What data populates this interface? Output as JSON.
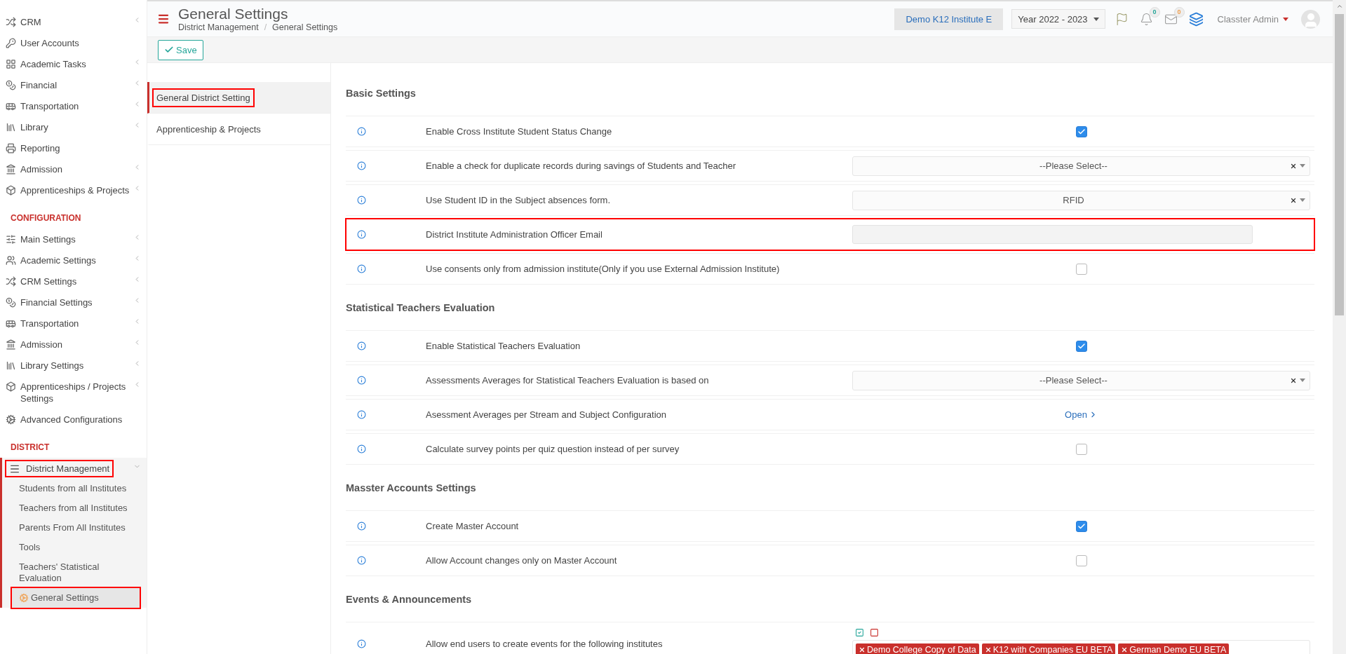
{
  "sidebar": {
    "groups": [
      {
        "items": [
          {
            "label": "CRM",
            "expandable": true
          },
          {
            "label": "User Accounts",
            "expandable": false
          },
          {
            "label": "Academic Tasks",
            "expandable": true
          },
          {
            "label": "Financial",
            "expandable": true
          },
          {
            "label": "Transportation",
            "expandable": true
          },
          {
            "label": "Library",
            "expandable": true
          },
          {
            "label": "Reporting",
            "expandable": false
          },
          {
            "label": "Admission",
            "expandable": true
          },
          {
            "label": "Apprenticeships & Projects",
            "expandable": true
          }
        ]
      },
      {
        "heading": "CONFIGURATION",
        "items": [
          {
            "label": "Main Settings",
            "expandable": true
          },
          {
            "label": "Academic Settings",
            "expandable": true
          },
          {
            "label": "CRM Settings",
            "expandable": true
          },
          {
            "label": "Financial Settings",
            "expandable": true
          },
          {
            "label": "Transportation",
            "expandable": true
          },
          {
            "label": "Admission",
            "expandable": true
          },
          {
            "label": "Library Settings",
            "expandable": true
          },
          {
            "label": "Apprenticeships / Projects Settings",
            "expandable": true
          },
          {
            "label": "Advanced Configurations",
            "expandable": false
          }
        ]
      },
      {
        "heading": "DISTRICT",
        "items": [
          {
            "label": "District Management",
            "expandable": true,
            "expanded": true,
            "highlighted": true,
            "children": [
              {
                "label": "Students from all Institutes",
                "selected": false,
                "highlighted": false
              },
              {
                "label": "Teachers from all Institutes",
                "selected": false,
                "highlighted": false
              },
              {
                "label": "Parents From All Institutes",
                "selected": false,
                "highlighted": false
              },
              {
                "label": "Tools",
                "selected": false,
                "highlighted": false
              },
              {
                "label": "Teachers' Statistical Evaluation",
                "selected": false,
                "highlighted": false
              },
              {
                "label": "General Settings",
                "selected": true,
                "highlighted": true
              }
            ]
          }
        ]
      }
    ]
  },
  "header": {
    "title": "General Settings",
    "breadcrumb": [
      "District Management",
      "General Settings"
    ],
    "breadcrumb_separator": "/",
    "institute": "Demo K12 Institute E",
    "year": "Year 2022 - 2023",
    "notifications": "0",
    "messages": "0",
    "user": "Classter Admin"
  },
  "toolbar": {
    "save": "Save"
  },
  "tabs": [
    {
      "label": "General District Setting",
      "selected": true,
      "highlighted": true
    },
    {
      "label": "Apprenticeship & Projects",
      "selected": false,
      "highlighted": false
    }
  ],
  "sections": [
    {
      "title": "Basic Settings",
      "rows": [
        {
          "kind": "checkbox",
          "label": "Enable Cross Institute Student Status Change",
          "checked": true,
          "highlighted": false
        },
        {
          "kind": "select",
          "label": "Enable a check for duplicate records during savings of Students and Teacher",
          "value": "--Please Select--",
          "highlighted": false
        },
        {
          "kind": "select",
          "label": "Use Student ID in the Subject absences form.",
          "value": "RFID",
          "highlighted": false
        },
        {
          "kind": "text",
          "label": "District Institute Administration Officer Email",
          "highlighted": true
        },
        {
          "kind": "checkbox",
          "label": "Use consents only from admission institute(Only if you use External Admission Institute)",
          "checked": false,
          "highlighted": false
        }
      ]
    },
    {
      "title": "Statistical Teachers Evaluation",
      "rows": [
        {
          "kind": "checkbox",
          "label": "Enable Statistical Teachers Evaluation",
          "checked": true,
          "highlighted": false
        },
        {
          "kind": "select",
          "label": "Assessments Averages for Statistical Teachers Evaluation is based on",
          "value": "--Please Select--",
          "highlighted": false
        },
        {
          "kind": "link",
          "label": "Asessment Averages per Stream and Subject Configuration",
          "link": "Open",
          "highlighted": false
        },
        {
          "kind": "checkbox",
          "label": "Calculate survey points per quiz question instead of per survey",
          "checked": false,
          "highlighted": false
        }
      ]
    },
    {
      "title": "Masster Accounts Settings",
      "rows": [
        {
          "kind": "checkbox",
          "label": "Create Master Account",
          "checked": true,
          "highlighted": false
        },
        {
          "kind": "checkbox",
          "label": "Allow Account changes only on Master Account",
          "checked": false,
          "highlighted": false
        }
      ]
    },
    {
      "title": "Events & Announcements",
      "rows": [
        {
          "kind": "multiselect",
          "label": "Allow end users to create events for the following institutes",
          "tags": [
            "Demo College Copy of Data",
            "K12 with Companies EU BETA",
            "German Demo EU BETA"
          ],
          "highlighted": false
        }
      ]
    }
  ]
}
